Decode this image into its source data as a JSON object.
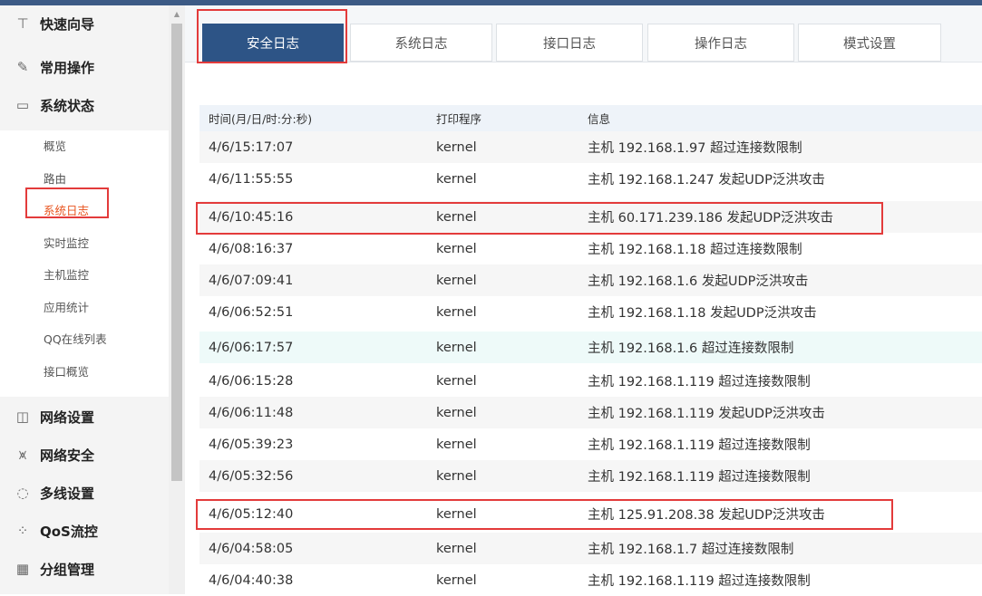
{
  "sidebar": {
    "nav_top": [
      {
        "label": "快速向导",
        "icon": "wizard-icon",
        "glyph": "⊤"
      },
      {
        "label": "常用操作",
        "icon": "wrench-icon",
        "glyph": "✎"
      },
      {
        "label": "系统状态",
        "icon": "monitor-icon",
        "glyph": "▭"
      }
    ],
    "sub_items": [
      {
        "label": "概览"
      },
      {
        "label": "路由"
      },
      {
        "label": "系统日志",
        "active": true
      },
      {
        "label": "实时监控"
      },
      {
        "label": "主机监控"
      },
      {
        "label": "应用统计"
      },
      {
        "label": "QQ在线列表"
      },
      {
        "label": "接口概览"
      }
    ],
    "nav_bottom": [
      {
        "label": "网络设置",
        "icon": "network-settings-icon",
        "glyph": "◫"
      },
      {
        "label": "网络安全",
        "icon": "network-security-icon",
        "glyph": "⩙"
      },
      {
        "label": "多线设置",
        "icon": "multiline-icon",
        "glyph": "◌"
      },
      {
        "label": "QoS流控",
        "icon": "qos-icon",
        "glyph": "⁘"
      },
      {
        "label": "分组管理",
        "icon": "group-icon",
        "glyph": "▦"
      }
    ]
  },
  "tabs": [
    {
      "label": "安全日志",
      "active": true
    },
    {
      "label": "系统日志"
    },
    {
      "label": "接口日志"
    },
    {
      "label": "操作日志"
    },
    {
      "label": "模式设置"
    }
  ],
  "table": {
    "headers": [
      "时间(月/日/时:分:秒)",
      "打印程序",
      "信息"
    ],
    "rows": [
      {
        "time": "4/6/15:17:07",
        "program": "kernel",
        "info": "主机 192.168.1.97 超过连接数限制"
      },
      {
        "time": "4/6/11:55:55",
        "program": "kernel",
        "info": "主机 192.168.1.247 发起UDP泛洪攻击"
      },
      {
        "time": "4/6/10:45:16",
        "program": "kernel",
        "info": "主机 60.171.239.186 发起UDP泛洪攻击"
      },
      {
        "time": "4/6/08:16:37",
        "program": "kernel",
        "info": "主机 192.168.1.18 超过连接数限制"
      },
      {
        "time": "4/6/07:09:41",
        "program": "kernel",
        "info": "主机 192.168.1.6 发起UDP泛洪攻击"
      },
      {
        "time": "4/6/06:52:51",
        "program": "kernel",
        "info": "主机 192.168.1.18 发起UDP泛洪攻击"
      },
      {
        "time": "4/6/06:17:57",
        "program": "kernel",
        "info": "主机 192.168.1.6 超过连接数限制"
      },
      {
        "time": "4/6/06:15:28",
        "program": "kernel",
        "info": "主机 192.168.1.119 超过连接数限制"
      },
      {
        "time": "4/6/06:11:48",
        "program": "kernel",
        "info": "主机 192.168.1.119 发起UDP泛洪攻击"
      },
      {
        "time": "4/6/05:39:23",
        "program": "kernel",
        "info": "主机 192.168.1.119 超过连接数限制"
      },
      {
        "time": "4/6/05:32:56",
        "program": "kernel",
        "info": "主机 192.168.1.119 超过连接数限制"
      },
      {
        "time": "4/6/05:12:40",
        "program": "kernel",
        "info": "主机 125.91.208.38 发起UDP泛洪攻击"
      },
      {
        "time": "4/6/04:58:05",
        "program": "kernel",
        "info": "主机 192.168.1.7 超过连接数限制"
      },
      {
        "time": "4/6/04:40:38",
        "program": "kernel",
        "info": "主机 192.168.1.119 超过连接数限制"
      }
    ]
  },
  "colors": {
    "accent": "#2d5486",
    "highlight_box": "#e33b3b",
    "active_sub_item": "#e8531d"
  }
}
